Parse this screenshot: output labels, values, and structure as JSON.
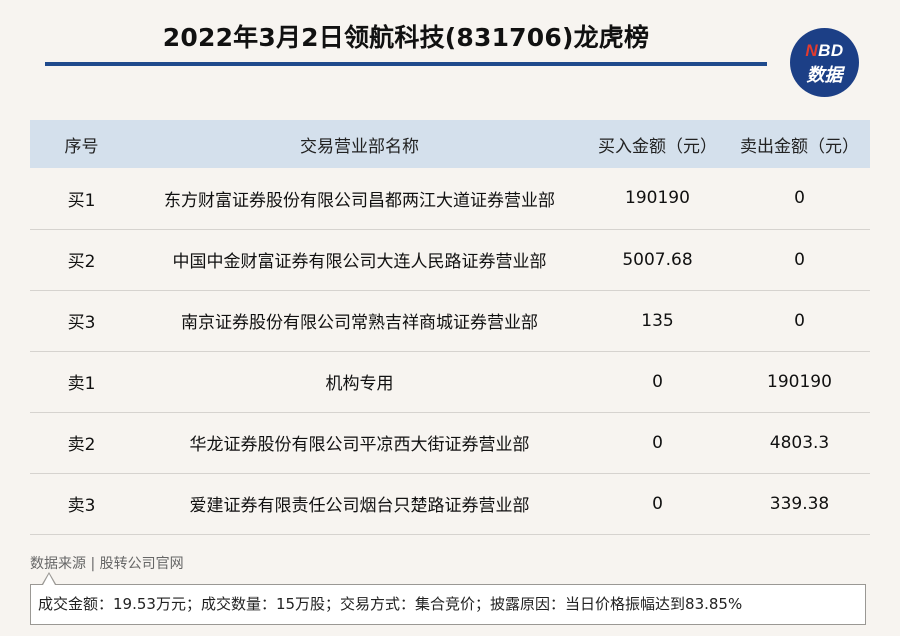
{
  "header": {
    "title": "2022年3月2日领航科技(831706)龙虎榜"
  },
  "logo": {
    "top_letter": "N",
    "top_rest": "BD",
    "bottom": "数据"
  },
  "table": {
    "columns": [
      "序号",
      "交易营业部名称",
      "买入金额（元）",
      "卖出金额（元）"
    ],
    "rows": [
      [
        "买1",
        "东方财富证券股份有限公司昌都两江大道证券营业部",
        "190190",
        "0"
      ],
      [
        "买2",
        "中国中金财富证券有限公司大连人民路证券营业部",
        "5007.68",
        "0"
      ],
      [
        "买3",
        "南京证券股份有限公司常熟吉祥商城证券营业部",
        "135",
        "0"
      ],
      [
        "卖1",
        "机构专用",
        "0",
        "190190"
      ],
      [
        "卖2",
        "华龙证券股份有限公司平凉西大街证券营业部",
        "0",
        "4803.3"
      ],
      [
        "卖3",
        "爱建证券有限责任公司烟台只楚路证券营业部",
        "0",
        "339.38"
      ]
    ]
  },
  "footer": {
    "source": "数据来源 | 股转公司官网",
    "note": "成交金额：19.53万元；成交数量：15万股；交易方式：集合竞价；披露原因：当日价格振幅达到83.85%"
  },
  "colors": {
    "accent": "#1f4a8c",
    "header_row": "#d4e0ec",
    "logo_bg": "#1c3f86",
    "logo_red": "#e23b2e",
    "page_bg": "#f7f4f0"
  }
}
